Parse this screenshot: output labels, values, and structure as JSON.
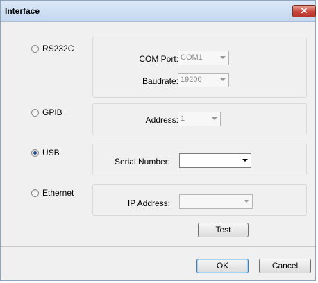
{
  "window": {
    "title": "Interface",
    "close_glyph": "✕"
  },
  "options": [
    {
      "label": "RS232C",
      "selected": false
    },
    {
      "label": "GPIB",
      "selected": false
    },
    {
      "label": "USB",
      "selected": true
    },
    {
      "label": "Ethernet",
      "selected": false
    }
  ],
  "rs232c": {
    "com_port_label": "COM Port:",
    "com_port_value": "COM1",
    "baudrate_label": "Baudrate:",
    "baudrate_value": "19200"
  },
  "gpib": {
    "address_label": "Address:",
    "address_value": "1"
  },
  "usb": {
    "serial_label": "Serial Number:",
    "serial_value": ""
  },
  "ethernet": {
    "ip_label": "IP Address:",
    "ip_value": ""
  },
  "buttons": {
    "test": "Test",
    "ok": "OK",
    "cancel": "Cancel"
  }
}
